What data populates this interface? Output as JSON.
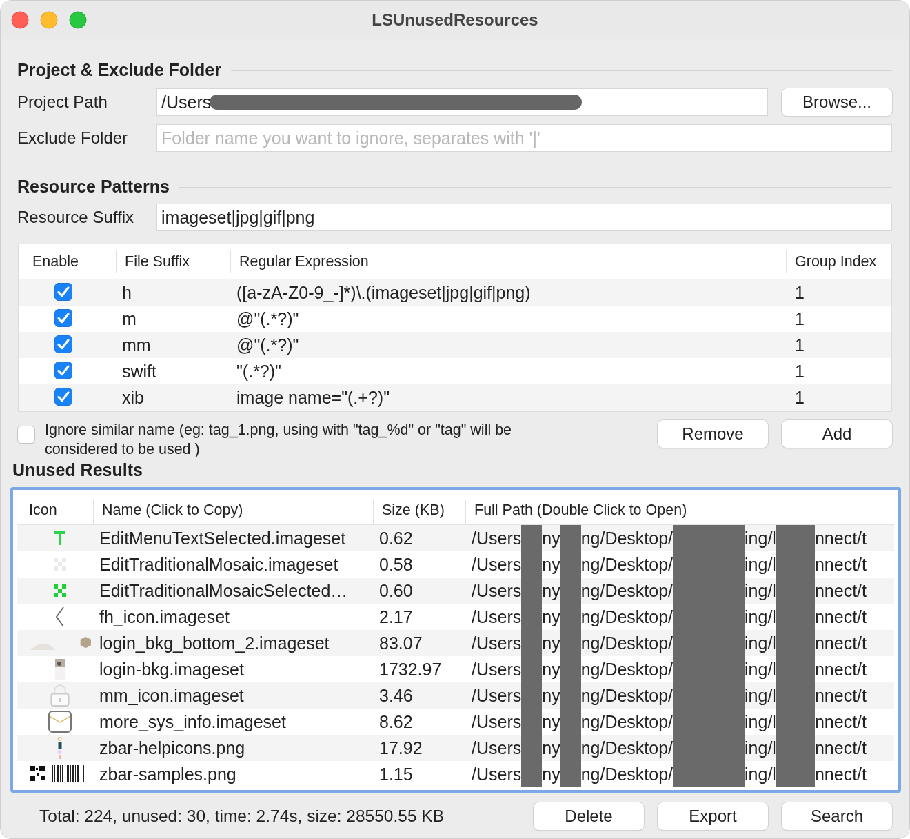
{
  "window": {
    "title": "LSUnusedResources"
  },
  "project_section": {
    "title": "Project & Exclude Folder",
    "project_path": {
      "label": "Project Path",
      "value": "/Users"
    },
    "browse_button": "Browse...",
    "exclude_folder": {
      "label": "Exclude Folder",
      "placeholder": "Folder name you want to ignore, separates with '|'"
    }
  },
  "patterns_section": {
    "title": "Resource Patterns",
    "resource_suffix": {
      "label": "Resource Suffix",
      "value": "imageset|jpg|gif|png"
    },
    "table": {
      "columns": [
        "Enable",
        "File Suffix",
        "Regular Expression",
        "Group Index"
      ],
      "rows": [
        {
          "enabled": true,
          "suffix": "h",
          "regex": "([a-zA-Z0-9_-]*)\\.(imageset|jpg|gif|png)",
          "group": "1"
        },
        {
          "enabled": true,
          "suffix": "m",
          "regex": "@\"(.*?)\"",
          "group": "1"
        },
        {
          "enabled": true,
          "suffix": "mm",
          "regex": "@\"(.*?)\"",
          "group": "1"
        },
        {
          "enabled": true,
          "suffix": "swift",
          "regex": "\"(.*?)\"",
          "group": "1"
        },
        {
          "enabled": true,
          "suffix": "xib",
          "regex": "image name=\"(.+?)\"",
          "group": "1"
        }
      ]
    },
    "ignore_similar": {
      "checked": false,
      "label": "Ignore similar name (eg: tag_1.png, using with \"tag_%d\" or \"tag\" will be considered to be used )"
    },
    "buttons": [
      "Remove",
      "Add"
    ]
  },
  "results_section": {
    "title": "Unused Results",
    "table": {
      "columns": [
        "Icon",
        "Name (Click to Copy)",
        "Size (KB)",
        "Full Path (Double Click to Open)"
      ],
      "rows": [
        {
          "name": "EditMenuTextSelected.imageset",
          "size": "0.62",
          "path": [
            "/Users",
            "ny",
            "ng/Desktop/",
            "ing/l",
            "nnect/t"
          ]
        },
        {
          "name": "EditTraditionalMosaic.imageset",
          "size": "0.58",
          "path": [
            "/Users",
            "ny",
            "ng/Desktop/",
            "ing/l",
            "nnect/t"
          ]
        },
        {
          "name": "EditTraditionalMosaicSelected…",
          "size": "0.60",
          "path": [
            "/Users",
            "ny",
            "ng/Desktop/",
            "ing/l",
            "nnect/t"
          ]
        },
        {
          "name": "fh_icon.imageset",
          "size": "2.17",
          "path": [
            "/Users",
            "ny",
            "ng/Desktop/",
            "ing/l",
            "nnect/t"
          ]
        },
        {
          "name": "login_bkg_bottom_2.imageset",
          "size": "83.07",
          "path": [
            "/Users",
            "ny",
            "ng/Desktop/",
            "ing/l",
            "nnect/t"
          ]
        },
        {
          "name": "login-bkg.imageset",
          "size": "1732.97",
          "path": [
            "/Users",
            "ny",
            "ng/Desktop/",
            "ing/l",
            "nnect/t"
          ]
        },
        {
          "name": "mm_icon.imageset",
          "size": "3.46",
          "path": [
            "/Users",
            "ny",
            "ng/Desktop/",
            "ing/l",
            "nnect/t"
          ]
        },
        {
          "name": "more_sys_info.imageset",
          "size": "8.62",
          "path": [
            "/Users",
            "ny",
            "ng/Desktop/",
            "ing/l",
            "nnect/t"
          ]
        },
        {
          "name": "zbar-helpicons.png",
          "size": "17.92",
          "path": [
            "/Users",
            "ny",
            "ng/Desktop/",
            "ing/l",
            "nnect/t"
          ]
        },
        {
          "name": "zbar-samples.png",
          "size": "1.15",
          "path": [
            "/Users",
            "ny",
            "ng/Desktop/",
            "ing/l",
            "nnect/t"
          ]
        }
      ]
    }
  },
  "status_bar": {
    "summary": "Total: 224, unused: 30, time: 2.74s, size: 28550.55 KB",
    "buttons": [
      "Delete",
      "Export",
      "Search"
    ]
  }
}
